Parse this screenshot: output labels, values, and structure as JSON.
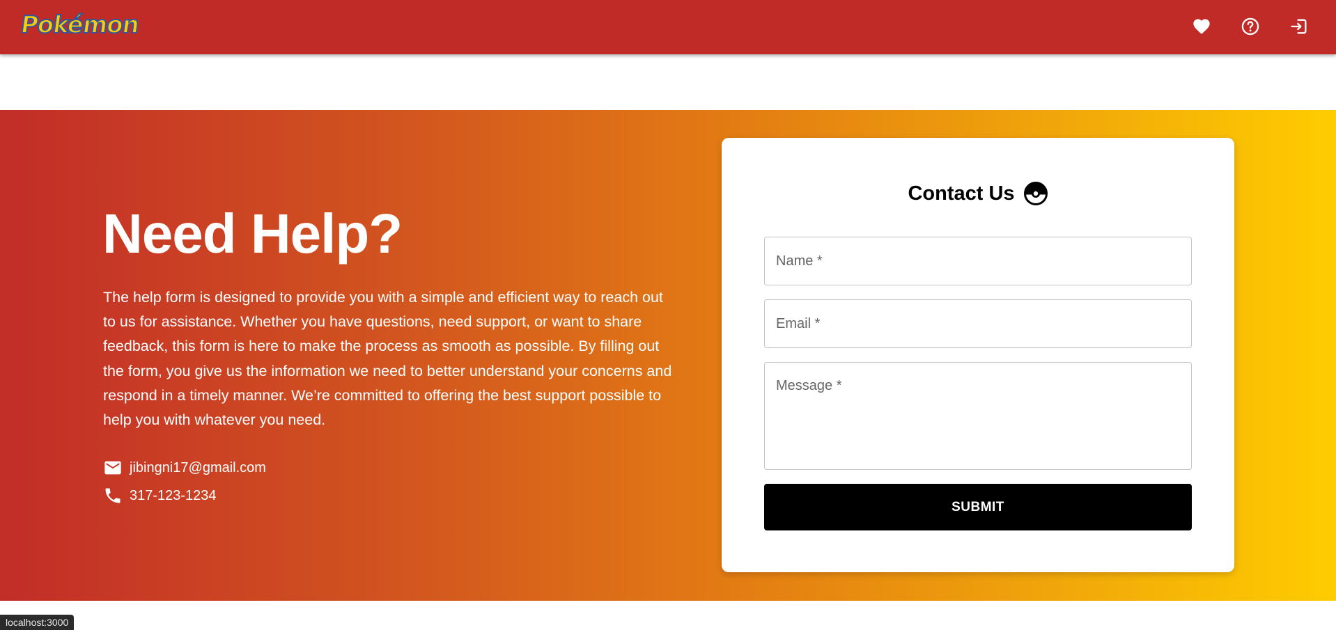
{
  "header": {
    "logo_text": "Pokémon",
    "icons": [
      "heart-icon",
      "help-circle-icon",
      "logout-icon"
    ],
    "background_color": "#c02b27"
  },
  "hero": {
    "title": "Need Help?",
    "description": "The help form is designed to provide you with a simple and efficient way to reach out to us for assistance. Whether you have questions, need support, or want to share feedback, this form is here to make the process as smooth as possible. By filling out the form, you give us the information we need to better understand your concerns and respond in a timely manner. We’re committed to offering the best support possible to help you with whatever you need.",
    "email": "jibingni17@gmail.com",
    "phone": "317-123-1234",
    "gradient_colors": [
      "#c22d28",
      "#e37c13",
      "#ffcc00"
    ]
  },
  "contact_form": {
    "title": "Contact Us",
    "name_placeholder": "Name *",
    "email_placeholder": "Email *",
    "message_placeholder": "Message *",
    "submit_label": "SUBMIT"
  },
  "status_bar": {
    "url": "localhost:3000"
  }
}
